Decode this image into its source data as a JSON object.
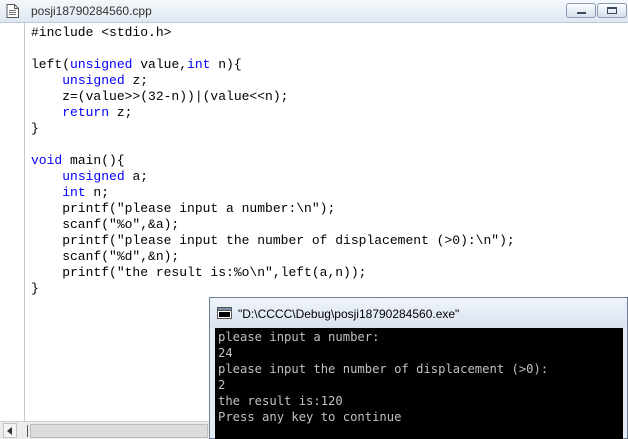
{
  "editor": {
    "title": "posji18790284560.cpp",
    "code_lines": [
      [
        {
          "t": "#include <stdio.h>",
          "k": false
        }
      ],
      [],
      [
        {
          "t": "left(",
          "k": false
        },
        {
          "t": "unsigned",
          "k": true
        },
        {
          "t": " value,",
          "k": false
        },
        {
          "t": "int",
          "k": true
        },
        {
          "t": " n){",
          "k": false
        }
      ],
      [
        {
          "t": "    ",
          "k": false
        },
        {
          "t": "unsigned",
          "k": true
        },
        {
          "t": " z;",
          "k": false
        }
      ],
      [
        {
          "t": "    z=(value>>(32-n))|(value<<n);",
          "k": false
        }
      ],
      [
        {
          "t": "    ",
          "k": false
        },
        {
          "t": "return",
          "k": true
        },
        {
          "t": " z;",
          "k": false
        }
      ],
      [
        {
          "t": "}",
          "k": false
        }
      ],
      [],
      [
        {
          "t": "void",
          "k": true
        },
        {
          "t": " main(){",
          "k": false
        }
      ],
      [
        {
          "t": "    ",
          "k": false
        },
        {
          "t": "unsigned",
          "k": true
        },
        {
          "t": " a;",
          "k": false
        }
      ],
      [
        {
          "t": "    ",
          "k": false
        },
        {
          "t": "int",
          "k": true
        },
        {
          "t": " n;",
          "k": false
        }
      ],
      [
        {
          "t": "    printf(\"please input a number:\\n\");",
          "k": false
        }
      ],
      [
        {
          "t": "    scanf(\"%o\",&a);",
          "k": false
        }
      ],
      [
        {
          "t": "    printf(\"please input the number of displacement (>0):\\n\");",
          "k": false
        }
      ],
      [
        {
          "t": "    scanf(\"%d\",&n);",
          "k": false
        }
      ],
      [
        {
          "t": "    printf(\"the result is:%o\\n\",left(a,n));",
          "k": false
        }
      ],
      [
        {
          "t": "}",
          "k": false
        }
      ]
    ]
  },
  "console": {
    "title": "\"D:\\CCCC\\Debug\\posji18790284560.exe\"",
    "lines": [
      "please input a number:",
      "24",
      "please input the number of displacement (>0):",
      "2",
      "the result is:120",
      "Press any key to continue"
    ]
  },
  "colors": {
    "keyword": "#0000ff",
    "text": "#000000",
    "console_bg": "#000000",
    "console_text": "#c0c0c0"
  },
  "icons": {
    "editor_doc": "document-icon",
    "console_app": "console-app-icon",
    "minimize": "minimize-icon",
    "maximize": "maximize-icon",
    "scroll_left": "arrow-left-icon"
  }
}
